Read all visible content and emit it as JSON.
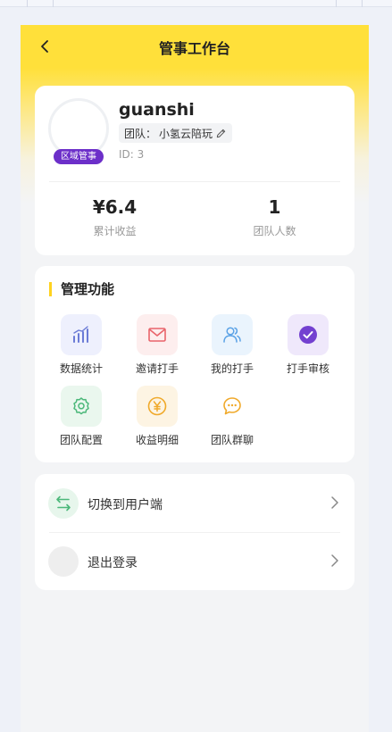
{
  "header": {
    "title": "管事工作台"
  },
  "profile": {
    "username": "guanshi",
    "role_badge": "区域管事",
    "team_label": "团队：",
    "team_name": "小氢云陪玩",
    "id_text": "ID: 3",
    "stats": [
      {
        "value": "¥6.4",
        "label": "累计收益"
      },
      {
        "value": "1",
        "label": "团队人数"
      }
    ]
  },
  "management": {
    "title": "管理功能",
    "items": [
      {
        "label": "数据统计",
        "icon": "bar-chart-icon"
      },
      {
        "label": "邀请打手",
        "icon": "mail-icon"
      },
      {
        "label": "我的打手",
        "icon": "users-icon"
      },
      {
        "label": "打手审核",
        "icon": "check-circle-icon"
      },
      {
        "label": "团队配置",
        "icon": "gear-icon"
      },
      {
        "label": "收益明细",
        "icon": "yen-coin-icon"
      },
      {
        "label": "团队群聊",
        "icon": "chat-bubble-icon"
      }
    ]
  },
  "menu": {
    "items": [
      {
        "label": "切换到用户端",
        "icon": "switch-arrows-icon"
      },
      {
        "label": "退出登录",
        "icon": "logout-icon"
      }
    ]
  },
  "colors": {
    "brand_yellow": "#ffe03a",
    "accent_yellow": "#ffd21f",
    "role_purple": "#6c2fc9"
  }
}
